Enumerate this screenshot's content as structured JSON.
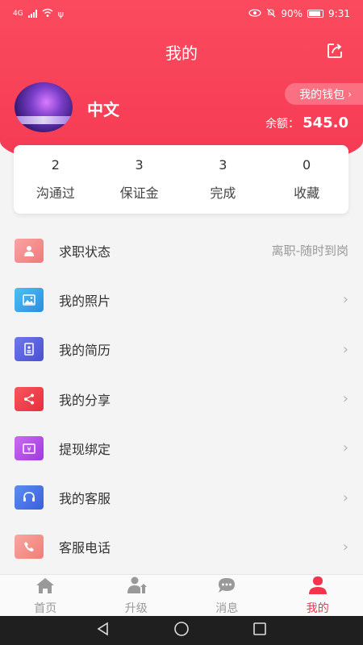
{
  "status_bar": {
    "network": "4G",
    "battery": "90%",
    "time": "9:31"
  },
  "header": {
    "title": "我的"
  },
  "profile": {
    "name": "中文",
    "wallet_label": "我的钱包",
    "balance_label": "余额：",
    "balance_value": "545.0"
  },
  "stats": [
    {
      "count": "2",
      "label": "沟通过"
    },
    {
      "count": "3",
      "label": "保证金"
    },
    {
      "count": "3",
      "label": "完成"
    },
    {
      "count": "0",
      "label": "收藏"
    }
  ],
  "menu": [
    {
      "label": "求职状态",
      "value": "离职-随时到岗",
      "icon": "person-icon",
      "color": "#f58a8a"
    },
    {
      "label": "我的照片",
      "value": "",
      "icon": "image-icon",
      "color": "#39a9e9"
    },
    {
      "label": "我的简历",
      "value": "",
      "icon": "resume-icon",
      "color": "#5b62e0"
    },
    {
      "label": "我的分享",
      "value": "",
      "icon": "share-icon",
      "color": "#f0424c"
    },
    {
      "label": "提现绑定",
      "value": "",
      "icon": "withdraw-icon",
      "color": "#b54ae6"
    },
    {
      "label": "我的客服",
      "value": "",
      "icon": "headset-icon",
      "color": "#4a72e8"
    },
    {
      "label": "客服电话",
      "value": "",
      "icon": "phone-icon",
      "color": "#f38e86"
    }
  ],
  "tabs": [
    {
      "label": "首页",
      "icon": "home-icon"
    },
    {
      "label": "升级",
      "icon": "upgrade-icon"
    },
    {
      "label": "消息",
      "icon": "message-icon"
    },
    {
      "label": "我的",
      "icon": "profile-icon",
      "active": true
    }
  ],
  "colors": {
    "brand": "#f53a53",
    "active_tab": "#f4334d"
  }
}
